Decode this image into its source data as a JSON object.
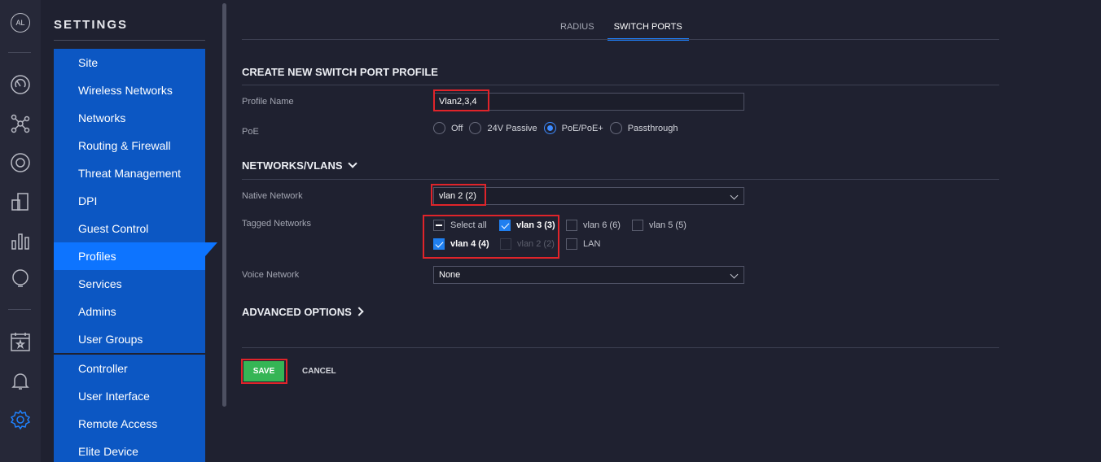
{
  "rail": {
    "avatar_initials": "AL",
    "icons": [
      "dashboard-icon",
      "topology-icon",
      "devices-icon",
      "clients-icon",
      "statistics-icon",
      "insights-icon",
      "events-icon",
      "alerts-icon",
      "settings-icon"
    ]
  },
  "sidebar": {
    "title": "SETTINGS",
    "group1": [
      "Site",
      "Wireless Networks",
      "Networks",
      "Routing & Firewall",
      "Threat Management",
      "DPI",
      "Guest Control",
      "Profiles",
      "Services",
      "Admins",
      "User Groups"
    ],
    "group2": [
      "Controller",
      "User Interface",
      "Remote Access",
      "Elite Device"
    ],
    "active": "Profiles"
  },
  "tabs": [
    "RADIUS",
    "SWITCH PORTS"
  ],
  "active_tab": "SWITCH PORTS",
  "form": {
    "section_title": "CREATE NEW SWITCH PORT PROFILE",
    "profile_name_label": "Profile Name",
    "profile_name_value": "Vlan2,3,4",
    "poe_label": "PoE",
    "poe_options": [
      "Off",
      "24V Passive",
      "PoE/PoE+",
      "Passthrough"
    ],
    "poe_selected": "PoE/PoE+",
    "networks_title": "NETWORKS/VLANS",
    "native_label": "Native Network",
    "native_value": "vlan 2 (2)",
    "tagged_label": "Tagged Networks",
    "tagged": {
      "select_all": "Select all",
      "vlan3": "vlan 3 (3)",
      "vlan6": "vlan 6 (6)",
      "vlan5": "vlan 5 (5)",
      "vlan4": "vlan 4 (4)",
      "vlan2": "vlan 2 (2)",
      "lan": "LAN"
    },
    "voice_label": "Voice Network",
    "voice_value": "None",
    "advanced_title": "ADVANCED OPTIONS",
    "save_label": "SAVE",
    "cancel_label": "CANCEL"
  },
  "colors": {
    "background": "#1f2130",
    "menu": "#0c57c3",
    "menu_active": "#0d74ff",
    "accent": "#1f82ff",
    "save": "#35b555",
    "highlight": "#e0242a"
  }
}
